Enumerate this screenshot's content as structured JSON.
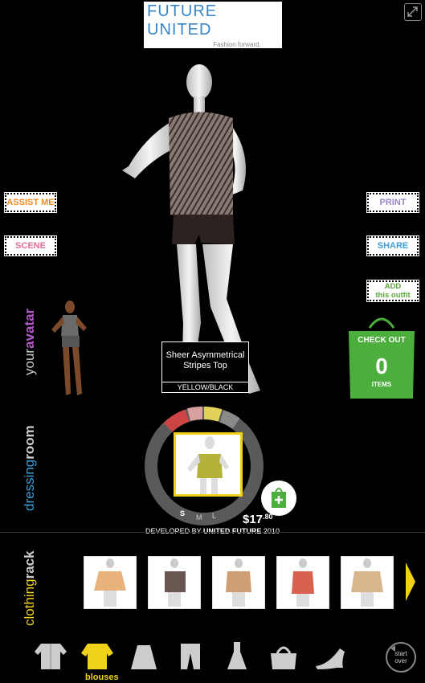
{
  "logo": {
    "title": "FUTURE UNITED",
    "tagline": "Fashion forward."
  },
  "left_buttons": {
    "assist": "ASSIST ME",
    "scene": "SCENE"
  },
  "right_buttons": {
    "print": "PRINT",
    "share": "SHARE",
    "add_line1": "ADD",
    "add_line2": "this outfit"
  },
  "side_labels": {
    "your_prefix": "your",
    "your_suffix": "avatar",
    "dress_prefix": "dressing",
    "dress_suffix": "room",
    "rack_prefix": "clothing",
    "rack_suffix": "rack"
  },
  "product": {
    "name": "Sheer Asymmetrical Stripes Top",
    "color": "YELLOW/BLACK",
    "price_main": "$17",
    "price_cents": ".80"
  },
  "sizes": [
    "S",
    "M",
    "L"
  ],
  "checkout": {
    "label": "CHECK OUT",
    "count": "0",
    "items_label": "ITEMS"
  },
  "developed": {
    "prefix": "DEVELOPED BY ",
    "brand": "UNITED FUTURE",
    "year": " 2010"
  },
  "rack_items": [
    {
      "color": "#e9b27c"
    },
    {
      "color": "#6a5650"
    },
    {
      "color": "#cf9e74"
    },
    {
      "color": "#d9614f"
    },
    {
      "color": "#d8b58c"
    }
  ],
  "categories": [
    "jacket-icon",
    "blouse-icon",
    "skirt-icon",
    "pants-icon",
    "dress-icon",
    "bag-icon",
    "shoe-icon"
  ],
  "selected_category": "blouses",
  "start_over": {
    "line1": "start",
    "line2": "over"
  },
  "colors": {
    "accent_yellow": "#f0d21b",
    "checkout_green": "#4cae3c"
  }
}
